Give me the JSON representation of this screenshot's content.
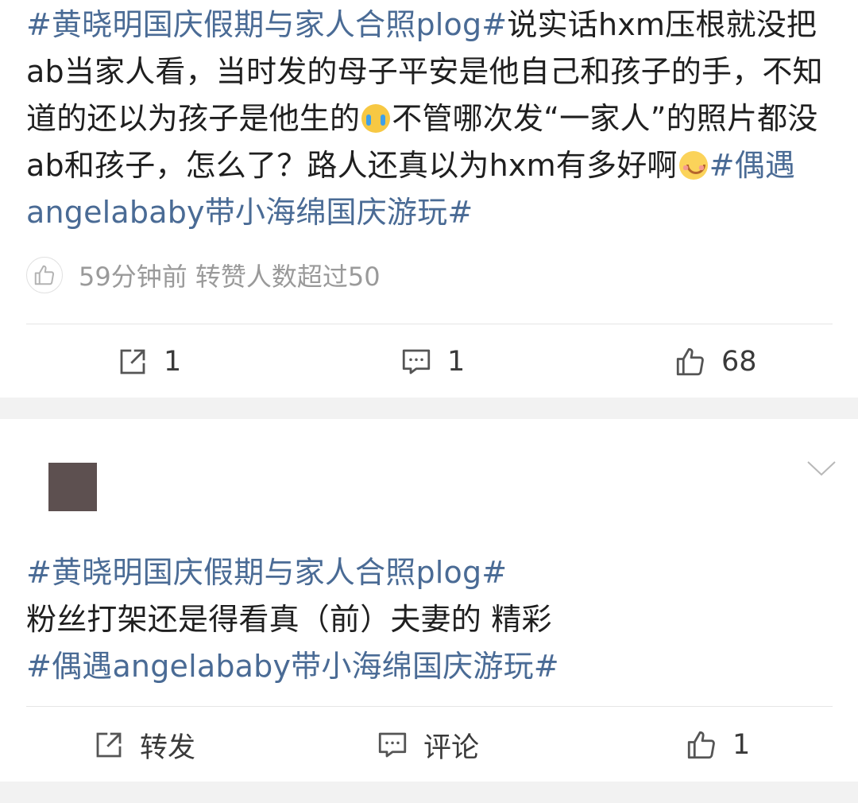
{
  "post1": {
    "topic_start": "#黄晓明国庆假期与家人合照plog#",
    "text_a": "说实话hxm压根就没把ab当家人看，当时发的母子平安是他自己和孩子的手，不知道的还以为孩子是他生的",
    "emoji_a": "crying-face-emoji",
    "text_b": "不管哪次发“一家人”的照片都没ab和孩子，怎么了？路人还真以为hxm有多好啊",
    "emoji_b": "smiling-face-emoji",
    "topic_end": "#偶遇angelababy带小海绵国庆游玩#",
    "meta": "59分钟前 转赞人数超过50",
    "repost_count": "1",
    "comment_count": "1",
    "like_count": "68"
  },
  "post2": {
    "topic_start": "#黄晓明国庆假期与家人合照plog#",
    "text": "粉丝打架还是得看真（前）夫妻的 精彩",
    "topic_end": "#偶遇angelababy带小海绵国庆游玩#",
    "repost_label": "转发",
    "comment_label": "评论",
    "like_count": "1"
  },
  "icons": {
    "repost": "share-icon",
    "comment": "comment-icon",
    "like": "thumbs-up-icon",
    "menu": "chevron-down-icon"
  },
  "colors": {
    "topic": "#4a6b95",
    "meta": "#9a9a9a",
    "avatar": "#5d5050"
  }
}
